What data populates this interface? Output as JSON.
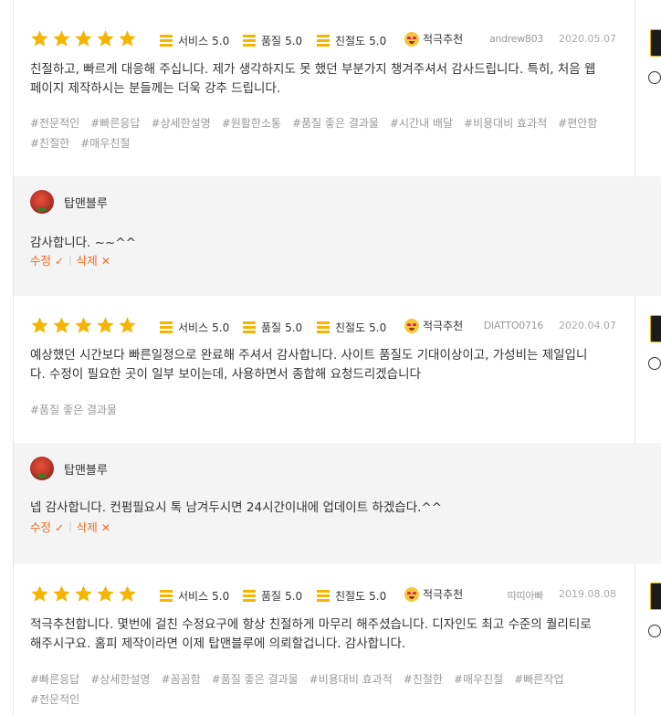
{
  "reviews": [
    {
      "rating_stars": 5,
      "metrics": [
        {
          "label": "서비스",
          "score": "5.0"
        },
        {
          "label": "품질",
          "score": "5.0"
        },
        {
          "label": "친절도",
          "score": "5.0"
        }
      ],
      "recommend": "적극추천",
      "user": "andrew803",
      "date": "2020.05.07",
      "text_line1": "친절하고, 빠르게 대응해 주십니다. 제가 생각하지도 못 했던 부분가지 챙겨주셔서 감사드립니다. 특히, 처음 웹",
      "text_line2": "페이지 제작하시는 분들께는 더욱 강추 드립니다.",
      "tags": [
        "#전문적인",
        "#빠른응답",
        "#상세한설명",
        "#원활한소통",
        "#품질 좋은 결과물",
        "#시간내 배달",
        "#비용대비 효과적",
        "#편안함",
        "#친절한",
        "#매우친절"
      ]
    },
    {
      "rating_stars": 5,
      "metrics": [
        {
          "label": "서비스",
          "score": "5.0"
        },
        {
          "label": "품질",
          "score": "5.0"
        },
        {
          "label": "친절도",
          "score": "5.0"
        }
      ],
      "recommend": "적극추천",
      "user": "DIATTO0716",
      "date": "2020.04.07",
      "text_line1": "예상했던 시간보다 빠른일정으로 완료해 주셔서 감사합니다. 사이트 품질도 기대이상이고, 가성비는 제일입니",
      "text_line2": "다. 수정이 필요한 곳이 일부 보이는데, 사용하면서 종합해 요청드리겠습니다",
      "tags": [
        "#품질 좋은 결과물"
      ]
    },
    {
      "rating_stars": 5,
      "metrics": [
        {
          "label": "서비스",
          "score": "5.0"
        },
        {
          "label": "품질",
          "score": "5.0"
        },
        {
          "label": "친절도",
          "score": "5.0"
        }
      ],
      "recommend": "적극추천",
      "user": "따띠아빠",
      "date": "2019.08.08",
      "text_line1": "적극추천합니다. 몇번에 걸친 수정요구에 항상 친절하게 마무리 해주셨습니다. 디자인도 최고 수준의 퀄리티로",
      "text_line2": "해주시구요. 홈피 제작이라면 이제 탑맨블루에 의뢰할겁니다. 감사합니다.",
      "tags": [
        "#빠른응답",
        "#상세한설명",
        "#꼼꼼함",
        "#품질 좋은 결과물",
        "#비용대비 효과적",
        "#친절한",
        "#매우친절",
        "#빠른작업",
        "#전문적인"
      ]
    }
  ],
  "replies": [
    {
      "name": "탑맨블루",
      "text": "감사합니다. ~~^^",
      "edit": "수정",
      "delete": "삭제"
    },
    {
      "name": "탑맨블루",
      "text": "넵 감사합니다. 컨펌필요시 톡 남겨두시면 24시간이내에 업데이트 하겠습다.^^",
      "edit": "수정",
      "delete": "삭제"
    }
  ],
  "colors": {
    "star": "#f5b400",
    "action": "#f26c22",
    "reply_bg": "#f4f4f4"
  },
  "icons": {
    "edit": "check-icon",
    "delete": "x-icon"
  }
}
